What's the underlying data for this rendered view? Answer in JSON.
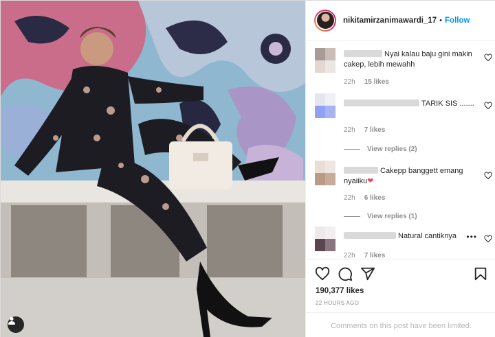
{
  "post": {
    "username": "nikitamirzanimawardi_17",
    "separator": "•",
    "follow_label": "Follow"
  },
  "comments": [
    {
      "text": "Nyai kalau baju gini makin cakep, lebih mewahh",
      "time": "22h",
      "likes": "15 likes"
    },
    {
      "text": "TARIK SIS .......",
      "time": "22h",
      "likes": "7 likes",
      "replies": "View replies (2)"
    },
    {
      "text": "Cakepp banggett emang nyaiiku",
      "emoji": "❤",
      "time": "22h",
      "likes": "6 likes",
      "replies": "View replies (1)"
    },
    {
      "text": "Natural cantiknya",
      "more": "•••",
      "time": "22h",
      "likes": "7 likes"
    }
  ],
  "actions": {
    "likes": "190,377 likes",
    "time_ago": "22 HOURS AGO",
    "comments_limited": "Comments on this post have been limited."
  },
  "colors": {
    "accent": "#0095f6",
    "heart": "#ed4956",
    "muted": "#8e8e8e"
  },
  "icons": [
    "heart-icon",
    "comment-icon",
    "share-icon",
    "bookmark-icon",
    "user-tag-icon"
  ]
}
